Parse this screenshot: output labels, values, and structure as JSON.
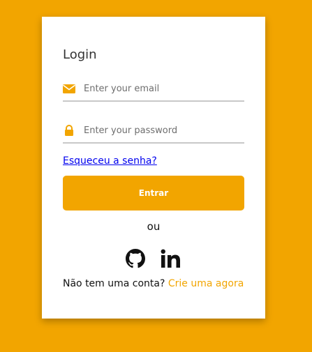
{
  "login": {
    "title": "Login",
    "email": {
      "placeholder": "Enter your email",
      "value": "",
      "icon": "envelope-icon"
    },
    "password": {
      "placeholder": "Enter your password",
      "value": "",
      "icon": "lock-icon"
    },
    "forgot_label": "Esqueceu a senha?",
    "submit_label": "Entrar",
    "or_label": "ou",
    "social": {
      "github_icon": "github-icon",
      "linkedin_icon": "linkedin-icon"
    },
    "signup_prompt": "Não tem uma conta?",
    "signup_link": "Crie uma agora"
  },
  "colors": {
    "background": "#f2a500",
    "card": "#ffffff",
    "accent": "#f2a500",
    "link": "#0000ee",
    "underline": "#c8c8c8"
  }
}
